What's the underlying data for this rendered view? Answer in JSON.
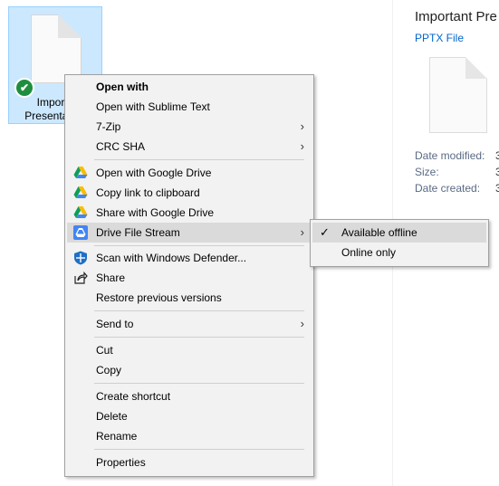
{
  "file": {
    "name_line1": "Importa",
    "name_line2": "Presentation",
    "badge": "✔"
  },
  "preview": {
    "title": "Important Pre",
    "type": "PPTX File",
    "fields": [
      {
        "label": "Date modified:",
        "value": "3"
      },
      {
        "label": "Size:",
        "value": "3"
      },
      {
        "label": "Date created:",
        "value": "3"
      }
    ]
  },
  "context_menu": {
    "items": [
      {
        "label": "Open with",
        "bold": true
      },
      {
        "label": "Open with Sublime Text"
      },
      {
        "label": "7-Zip",
        "submenu": true
      },
      {
        "label": "CRC SHA",
        "submenu": true
      },
      {
        "label": "Open with Google Drive",
        "icon": "google-drive-icon"
      },
      {
        "label": "Copy link to clipboard",
        "icon": "google-drive-icon"
      },
      {
        "label": "Share with Google Drive",
        "icon": "google-drive-icon"
      },
      {
        "label": "Drive File Stream",
        "icon": "drive-file-stream-icon",
        "submenu": true,
        "highlighted": true
      },
      {
        "label": "Scan with Windows Defender...",
        "icon": "windows-defender-icon"
      },
      {
        "label": "Share",
        "icon": "share-icon"
      },
      {
        "label": "Restore previous versions"
      },
      {
        "label": "Send to",
        "submenu": true
      },
      {
        "label": "Cut"
      },
      {
        "label": "Copy"
      },
      {
        "label": "Create shortcut"
      },
      {
        "label": "Delete"
      },
      {
        "label": "Rename"
      },
      {
        "label": "Properties"
      }
    ],
    "arrow_glyph": "›"
  },
  "submenu": {
    "items": [
      {
        "label": "Available offline",
        "checked": true,
        "highlighted": true
      },
      {
        "label": "Online only"
      }
    ],
    "check_glyph": "✓"
  }
}
